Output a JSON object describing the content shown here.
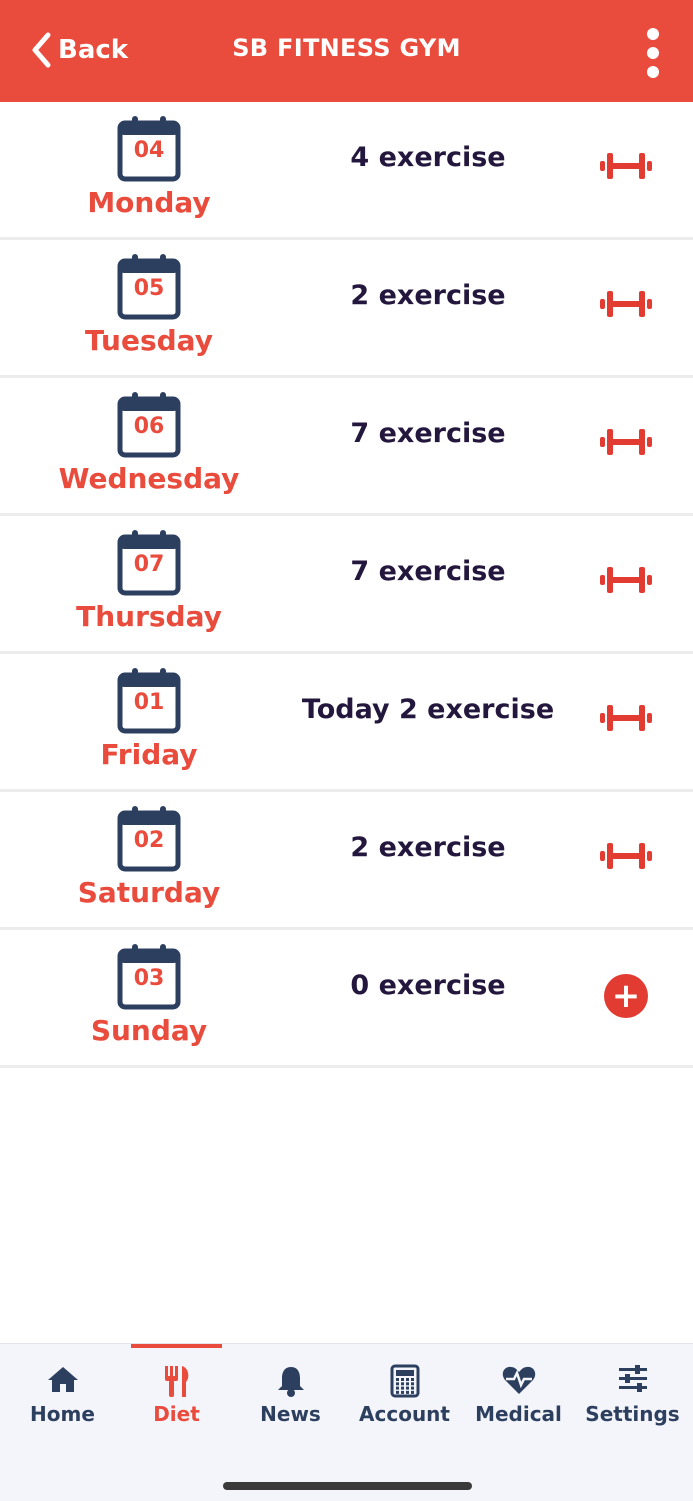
{
  "header": {
    "back_label": "Back",
    "title": "SB FITNESS GYM"
  },
  "days": [
    {
      "date": "04",
      "name": "Monday",
      "count": "4 exercise",
      "action": "dumbbell-icon"
    },
    {
      "date": "05",
      "name": "Tuesday",
      "count": "2 exercise",
      "action": "dumbbell-icon"
    },
    {
      "date": "06",
      "name": "Wednesday",
      "count": "7 exercise",
      "action": "dumbbell-icon"
    },
    {
      "date": "07",
      "name": "Thursday",
      "count": "7 exercise",
      "action": "dumbbell-icon"
    },
    {
      "date": "01",
      "name": "Friday",
      "count": "Today 2 exercise",
      "action": "dumbbell-icon"
    },
    {
      "date": "02",
      "name": "Saturday",
      "count": "2 exercise",
      "action": "dumbbell-icon"
    },
    {
      "date": "03",
      "name": "Sunday",
      "count": "0 exercise",
      "action": "add-icon"
    }
  ],
  "tabs": [
    {
      "label": "Home",
      "icon": "home-icon",
      "active": false
    },
    {
      "label": "Diet",
      "icon": "utensils-icon",
      "active": true
    },
    {
      "label": "News",
      "icon": "bell-icon",
      "active": false
    },
    {
      "label": "Account",
      "icon": "calculator-icon",
      "active": false
    },
    {
      "label": "Medical",
      "icon": "heartbeat-icon",
      "active": false
    },
    {
      "label": "Settings",
      "icon": "sliders-icon",
      "active": false
    }
  ],
  "colors": {
    "accent": "#e94b3c",
    "calendar": "#2d3f5f",
    "count_text": "#24173d",
    "tabbar_bg": "#f4f5fb"
  }
}
